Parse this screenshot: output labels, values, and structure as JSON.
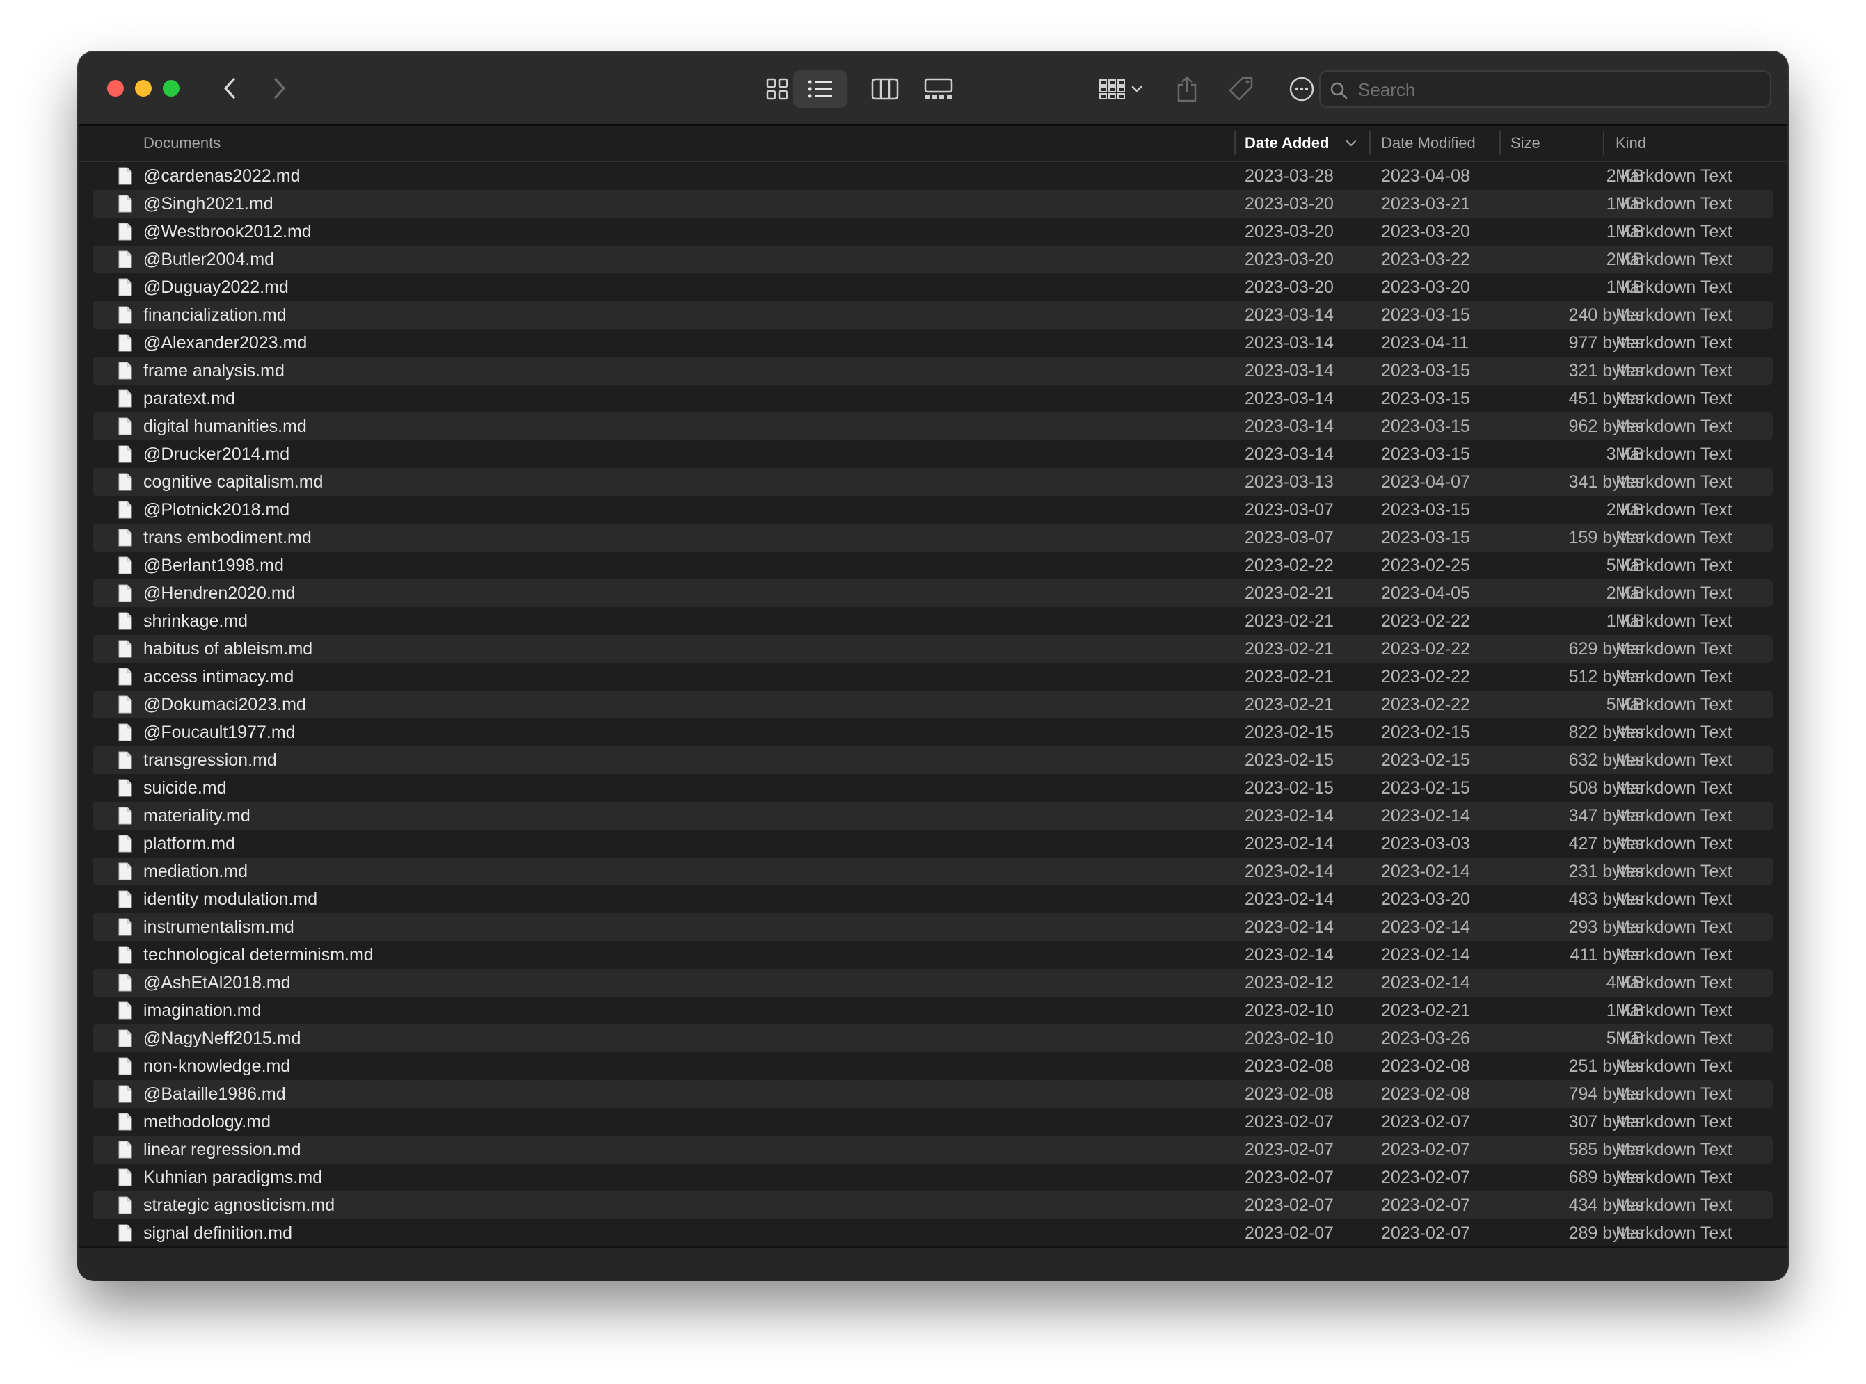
{
  "window": {
    "title": "Documents"
  },
  "toolbar": {
    "icons": [
      "chevron-left-icon",
      "chevron-right-icon",
      "icon-view-icon",
      "list-view-icon",
      "column-view-icon",
      "gallery-view-icon",
      "group-by-icon",
      "share-icon",
      "tag-icon",
      "more-actions-icon"
    ],
    "selected_view": "list"
  },
  "search": {
    "placeholder": "Search",
    "value": ""
  },
  "columns": {
    "name": "Documents",
    "date_added": "Date Added",
    "date_modified": "Date Modified",
    "size": "Size",
    "kind": "Kind",
    "sorted_by": "date_added"
  },
  "colors": {
    "window_bg": "#1e1e1e",
    "row_alt": "#2a2a2a",
    "text": "#e6e6e6",
    "secondary_text": "#b4b4b4"
  },
  "files": [
    {
      "name": "@cardenas2022.md",
      "added": "2023-03-28",
      "modified": "2023-04-08",
      "size": "2 KB",
      "kind": "Markdown Text"
    },
    {
      "name": "@Singh2021.md",
      "added": "2023-03-20",
      "modified": "2023-03-21",
      "size": "1 KB",
      "kind": "Markdown Text"
    },
    {
      "name": "@Westbrook2012.md",
      "added": "2023-03-20",
      "modified": "2023-03-20",
      "size": "1 KB",
      "kind": "Markdown Text"
    },
    {
      "name": "@Butler2004.md",
      "added": "2023-03-20",
      "modified": "2023-03-22",
      "size": "2 KB",
      "kind": "Markdown Text"
    },
    {
      "name": "@Duguay2022.md",
      "added": "2023-03-20",
      "modified": "2023-03-20",
      "size": "1 KB",
      "kind": "Markdown Text"
    },
    {
      "name": "financialization.md",
      "added": "2023-03-14",
      "modified": "2023-03-15",
      "size": "240 bytes",
      "kind": "Markdown Text"
    },
    {
      "name": "@Alexander2023.md",
      "added": "2023-03-14",
      "modified": "2023-04-11",
      "size": "977 bytes",
      "kind": "Markdown Text"
    },
    {
      "name": "frame analysis.md",
      "added": "2023-03-14",
      "modified": "2023-03-15",
      "size": "321 bytes",
      "kind": "Markdown Text"
    },
    {
      "name": "paratext.md",
      "added": "2023-03-14",
      "modified": "2023-03-15",
      "size": "451 bytes",
      "kind": "Markdown Text"
    },
    {
      "name": "digital humanities.md",
      "added": "2023-03-14",
      "modified": "2023-03-15",
      "size": "962 bytes",
      "kind": "Markdown Text"
    },
    {
      "name": "@Drucker2014.md",
      "added": "2023-03-14",
      "modified": "2023-03-15",
      "size": "3 KB",
      "kind": "Markdown Text"
    },
    {
      "name": "cognitive capitalism.md",
      "added": "2023-03-13",
      "modified": "2023-04-07",
      "size": "341 bytes",
      "kind": "Markdown Text"
    },
    {
      "name": "@Plotnick2018.md",
      "added": "2023-03-07",
      "modified": "2023-03-15",
      "size": "2 KB",
      "kind": "Markdown Text"
    },
    {
      "name": "trans embodiment.md",
      "added": "2023-03-07",
      "modified": "2023-03-15",
      "size": "159 bytes",
      "kind": "Markdown Text"
    },
    {
      "name": "@Berlant1998.md",
      "added": "2023-02-22",
      "modified": "2023-02-25",
      "size": "5 KB",
      "kind": "Markdown Text"
    },
    {
      "name": "@Hendren2020.md",
      "added": "2023-02-21",
      "modified": "2023-04-05",
      "size": "2 KB",
      "kind": "Markdown Text"
    },
    {
      "name": "shrinkage.md",
      "added": "2023-02-21",
      "modified": "2023-02-22",
      "size": "1 KB",
      "kind": "Markdown Text"
    },
    {
      "name": "habitus of ableism.md",
      "added": "2023-02-21",
      "modified": "2023-02-22",
      "size": "629 bytes",
      "kind": "Markdown Text"
    },
    {
      "name": "access intimacy.md",
      "added": "2023-02-21",
      "modified": "2023-02-22",
      "size": "512 bytes",
      "kind": "Markdown Text"
    },
    {
      "name": "@Dokumaci2023.md",
      "added": "2023-02-21",
      "modified": "2023-02-22",
      "size": "5 KB",
      "kind": "Markdown Text"
    },
    {
      "name": "@Foucault1977.md",
      "added": "2023-02-15",
      "modified": "2023-02-15",
      "size": "822 bytes",
      "kind": "Markdown Text"
    },
    {
      "name": "transgression.md",
      "added": "2023-02-15",
      "modified": "2023-02-15",
      "size": "632 bytes",
      "kind": "Markdown Text"
    },
    {
      "name": "suicide.md",
      "added": "2023-02-15",
      "modified": "2023-02-15",
      "size": "508 bytes",
      "kind": "Markdown Text"
    },
    {
      "name": "materiality.md",
      "added": "2023-02-14",
      "modified": "2023-02-14",
      "size": "347 bytes",
      "kind": "Markdown Text"
    },
    {
      "name": "platform.md",
      "added": "2023-02-14",
      "modified": "2023-03-03",
      "size": "427 bytes",
      "kind": "Markdown Text"
    },
    {
      "name": "mediation.md",
      "added": "2023-02-14",
      "modified": "2023-02-14",
      "size": "231 bytes",
      "kind": "Markdown Text"
    },
    {
      "name": "identity modulation.md",
      "added": "2023-02-14",
      "modified": "2023-03-20",
      "size": "483 bytes",
      "kind": "Markdown Text"
    },
    {
      "name": "instrumentalism.md",
      "added": "2023-02-14",
      "modified": "2023-02-14",
      "size": "293 bytes",
      "kind": "Markdown Text"
    },
    {
      "name": "technological determinism.md",
      "added": "2023-02-14",
      "modified": "2023-02-14",
      "size": "411 bytes",
      "kind": "Markdown Text"
    },
    {
      "name": "@AshEtAl2018.md",
      "added": "2023-02-12",
      "modified": "2023-02-14",
      "size": "4 KB",
      "kind": "Markdown Text"
    },
    {
      "name": "imagination.md",
      "added": "2023-02-10",
      "modified": "2023-02-21",
      "size": "1 KB",
      "kind": "Markdown Text"
    },
    {
      "name": "@NagyNeff2015.md",
      "added": "2023-02-10",
      "modified": "2023-03-26",
      "size": "5 KB",
      "kind": "Markdown Text"
    },
    {
      "name": "non-knowledge.md",
      "added": "2023-02-08",
      "modified": "2023-02-08",
      "size": "251 bytes",
      "kind": "Markdown Text"
    },
    {
      "name": "@Bataille1986.md",
      "added": "2023-02-08",
      "modified": "2023-02-08",
      "size": "794 bytes",
      "kind": "Markdown Text"
    },
    {
      "name": "methodology.md",
      "added": "2023-02-07",
      "modified": "2023-02-07",
      "size": "307 bytes",
      "kind": "Markdown Text"
    },
    {
      "name": "linear regression.md",
      "added": "2023-02-07",
      "modified": "2023-02-07",
      "size": "585 bytes",
      "kind": "Markdown Text"
    },
    {
      "name": "Kuhnian paradigms.md",
      "added": "2023-02-07",
      "modified": "2023-02-07",
      "size": "689 bytes",
      "kind": "Markdown Text"
    },
    {
      "name": "strategic agnosticism.md",
      "added": "2023-02-07",
      "modified": "2023-02-07",
      "size": "434 bytes",
      "kind": "Markdown Text"
    },
    {
      "name": "signal definition.md",
      "added": "2023-02-07",
      "modified": "2023-02-07",
      "size": "289 bytes",
      "kind": "Markdown Text"
    }
  ]
}
